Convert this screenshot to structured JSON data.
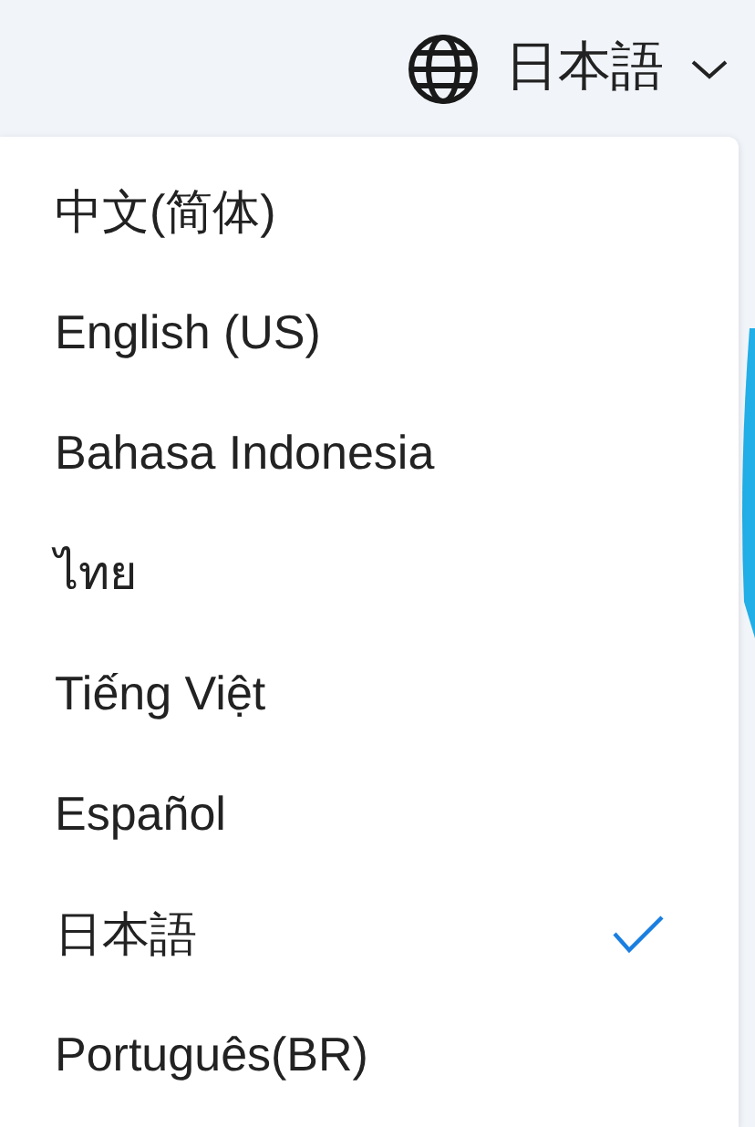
{
  "language_selector": {
    "current": "日本語",
    "expanded": true
  },
  "languages": [
    {
      "label": "中文(简体)",
      "selected": false
    },
    {
      "label": "English (US)",
      "selected": false
    },
    {
      "label": "Bahasa Indonesia",
      "selected": false
    },
    {
      "label": "ไทย",
      "selected": false
    },
    {
      "label": "Tiếng Việt",
      "selected": false
    },
    {
      "label": "Español",
      "selected": false
    },
    {
      "label": "日本語",
      "selected": true
    },
    {
      "label": "Português(BR)",
      "selected": false
    }
  ]
}
